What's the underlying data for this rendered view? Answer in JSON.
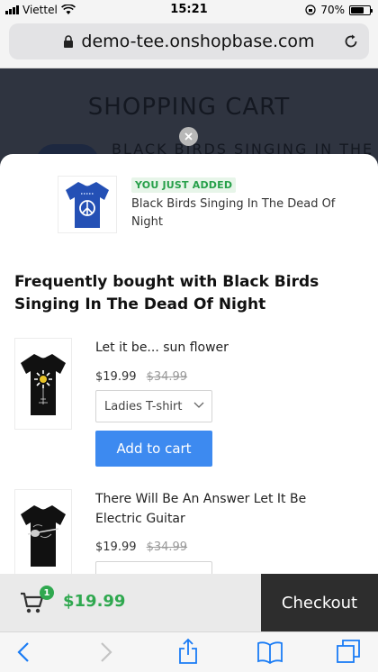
{
  "status_bar": {
    "carrier": "Viettel",
    "time": "15:21",
    "battery": "70%",
    "battery_level": 0.7
  },
  "browser": {
    "url": "demo-tee.onshopbase.com"
  },
  "background_page": {
    "title": "SHOPPING CART",
    "product_title": "BLACK BIRDS SINGING IN THE"
  },
  "just_added": {
    "badge": "YOU JUST ADDED",
    "product_name": "Black Birds Singing In The Dead Of Night"
  },
  "fbt": {
    "title": "Frequently bought with Black Birds Singing In The Dead Of Night",
    "products": [
      {
        "name": "Let it be... sun flower",
        "price": "$19.99",
        "compare_price": "$34.99",
        "variant": "Ladies T-shirt",
        "button": "Add to cart"
      },
      {
        "name": "There Will Be An Answer Let It Be Electric Guitar",
        "price": "$19.99",
        "compare_price": "$34.99"
      }
    ]
  },
  "cart_bar": {
    "count": "1",
    "total": "$19.99",
    "checkout_label": "Checkout"
  },
  "colors": {
    "accent_green": "#2fa84f",
    "button_blue": "#3d8af0",
    "checkout_dark": "#2d2d2d",
    "ios_blue": "#1a7cf5"
  }
}
